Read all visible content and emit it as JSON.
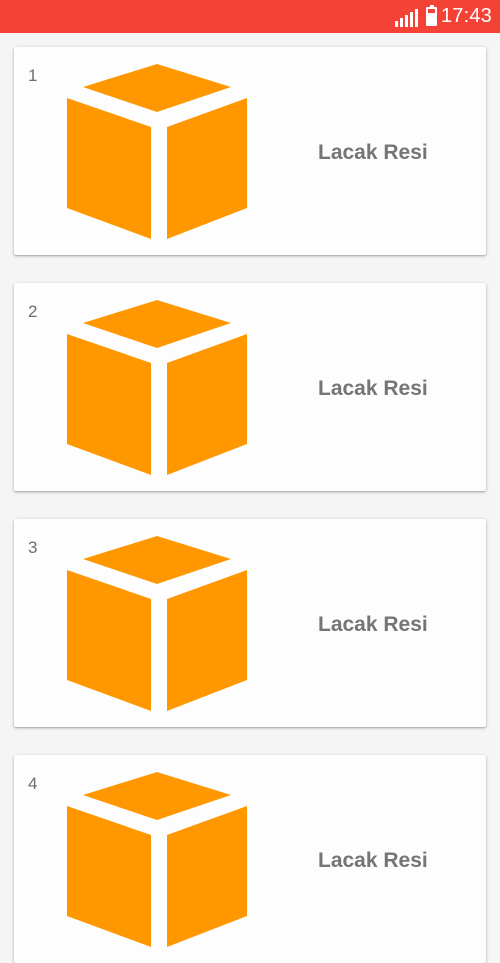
{
  "status_bar": {
    "time": "17:43",
    "signal_icon": "signal-icon",
    "battery_icon": "battery-icon",
    "background": "#f44336"
  },
  "list": {
    "items": [
      {
        "number": "1",
        "label": "Lacak Resi",
        "icon": "package-box-icon"
      },
      {
        "number": "2",
        "label": "Lacak Resi",
        "icon": "package-box-icon"
      },
      {
        "number": "3",
        "label": "Lacak Resi",
        "icon": "package-box-icon"
      },
      {
        "number": "4",
        "label": "Lacak Resi",
        "icon": "package-box-icon"
      }
    ]
  },
  "colors": {
    "box": "#ff9800",
    "label": "#757575",
    "card": "#fdfdfd"
  }
}
